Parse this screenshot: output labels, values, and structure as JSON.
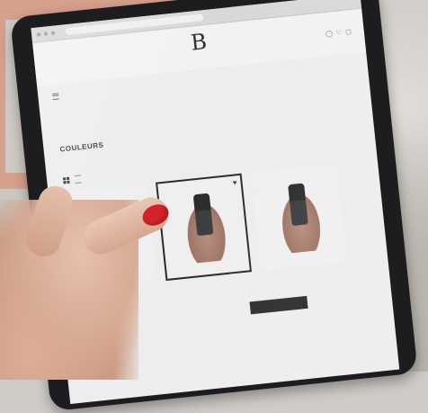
{
  "scene": {
    "colors": {
      "peach_panel": "#d5a08c",
      "tablet_frame": "#1d1d1f",
      "nail_polish": "#d2232a",
      "screen": "#ededed"
    }
  },
  "website": {
    "header": {
      "logo_text": "B",
      "icons": [
        "user-icon",
        "heart-icon",
        "cart-icon"
      ]
    },
    "section_title": "COULEURS",
    "products": [
      {
        "name": "product-1",
        "selected": false
      },
      {
        "name": "product-2",
        "selected": true
      },
      {
        "name": "product-3",
        "selected": false
      }
    ]
  }
}
